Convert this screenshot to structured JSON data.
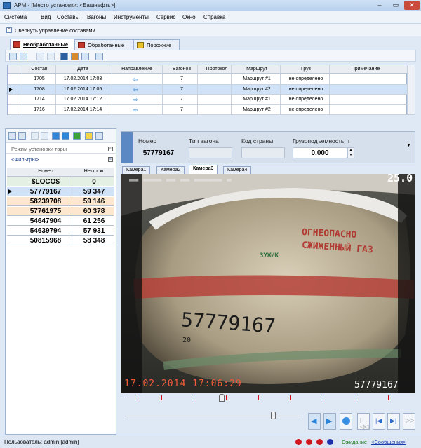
{
  "window": {
    "title": "АРМ - [Место установки: <Башнефть>]",
    "min": "–",
    "max": "▭",
    "close": "✕"
  },
  "menu": [
    "Система",
    "Вид",
    "Составы",
    "Вагоны",
    "Инструменты",
    "Сервис",
    "Окно",
    "Справка"
  ],
  "collapse_label": "Свернуть управление составами",
  "top_tabs": [
    "Необработанные",
    "Обработанные",
    "Порожние"
  ],
  "trains_table": {
    "columns": [
      "Состав",
      "Дата",
      "Направление",
      "Вагонов",
      "Протокол",
      "Маршрут",
      "Груз",
      "Примечание"
    ],
    "rows": [
      {
        "sostav": "1705",
        "date": "17.02.2014 17:03",
        "dir": "left",
        "wagons": "7",
        "protocol": "",
        "route": "Маршрут #1",
        "cargo": "не определено",
        "note": ""
      },
      {
        "sostav": "1708",
        "date": "17.02.2014 17:05",
        "dir": "left",
        "wagons": "7",
        "protocol": "",
        "route": "Маршрут #2",
        "cargo": "не определено",
        "note": ""
      },
      {
        "sostav": "1714",
        "date": "17.02.2014 17:12",
        "dir": "right",
        "wagons": "7",
        "protocol": "",
        "route": "Маршрут #1",
        "cargo": "не определено",
        "note": ""
      },
      {
        "sostav": "1716",
        "date": "17.02.2014 17:14",
        "dir": "right",
        "wagons": "7",
        "protocol": "",
        "route": "Маршрут #2",
        "cargo": "не определено",
        "note": ""
      }
    ],
    "selected_index": 1
  },
  "left_panel": {
    "tare_mode": "Режим установки тары",
    "filters": "<Фильтры>",
    "columns": [
      "Номер",
      "Нетто, кг"
    ],
    "rows": [
      {
        "num": "$LOCO$",
        "net": "0",
        "style": "loco"
      },
      {
        "num": "57779167",
        "net": "59 347",
        "style": "selected"
      },
      {
        "num": "58239708",
        "net": "59 146",
        "style": "orange"
      },
      {
        "num": "57761975",
        "net": "60 378",
        "style": "orange"
      },
      {
        "num": "54647904",
        "net": "61 256",
        "style": "white"
      },
      {
        "num": "54639794",
        "net": "57 931",
        "style": "white"
      },
      {
        "num": "50815968",
        "net": "58 348",
        "style": "white"
      }
    ]
  },
  "info": {
    "nomer_label": "Номер",
    "tip_label": "Тип вагона",
    "kod_label": "Код страны",
    "gruz_label": "Грузоподъемность, т",
    "nomer_value": "57779167",
    "tip_value": "",
    "kod_value": "",
    "gruz_value": "0,000"
  },
  "camera_tabs": [
    "Камера1",
    "Камера2",
    "Камера3",
    "Камера4"
  ],
  "camera": {
    "top_value": "25.0",
    "timestamp": "17.02.2014 17:06:29",
    "wagon_number": "57779167",
    "tank_text_1": "ОГНЕОПАСНО",
    "tank_text_2": "СЖИЖЕННЫЙ ГАЗ",
    "tank_number": "57779167",
    "tank_small": "20",
    "tank_logo": "ЗУЖИК"
  },
  "status": {
    "user": "Пользователь: admin [admin]",
    "waiting": "Ожидание",
    "messages": "<Сообщения>"
  },
  "colors": {
    "accent": "#5b88c3",
    "selected": "#cfe2f7",
    "orange": "#fde7cf",
    "loco": "#e3f0e3",
    "dot_red": "#d0161e",
    "dot_blue": "#1f2fa8"
  }
}
